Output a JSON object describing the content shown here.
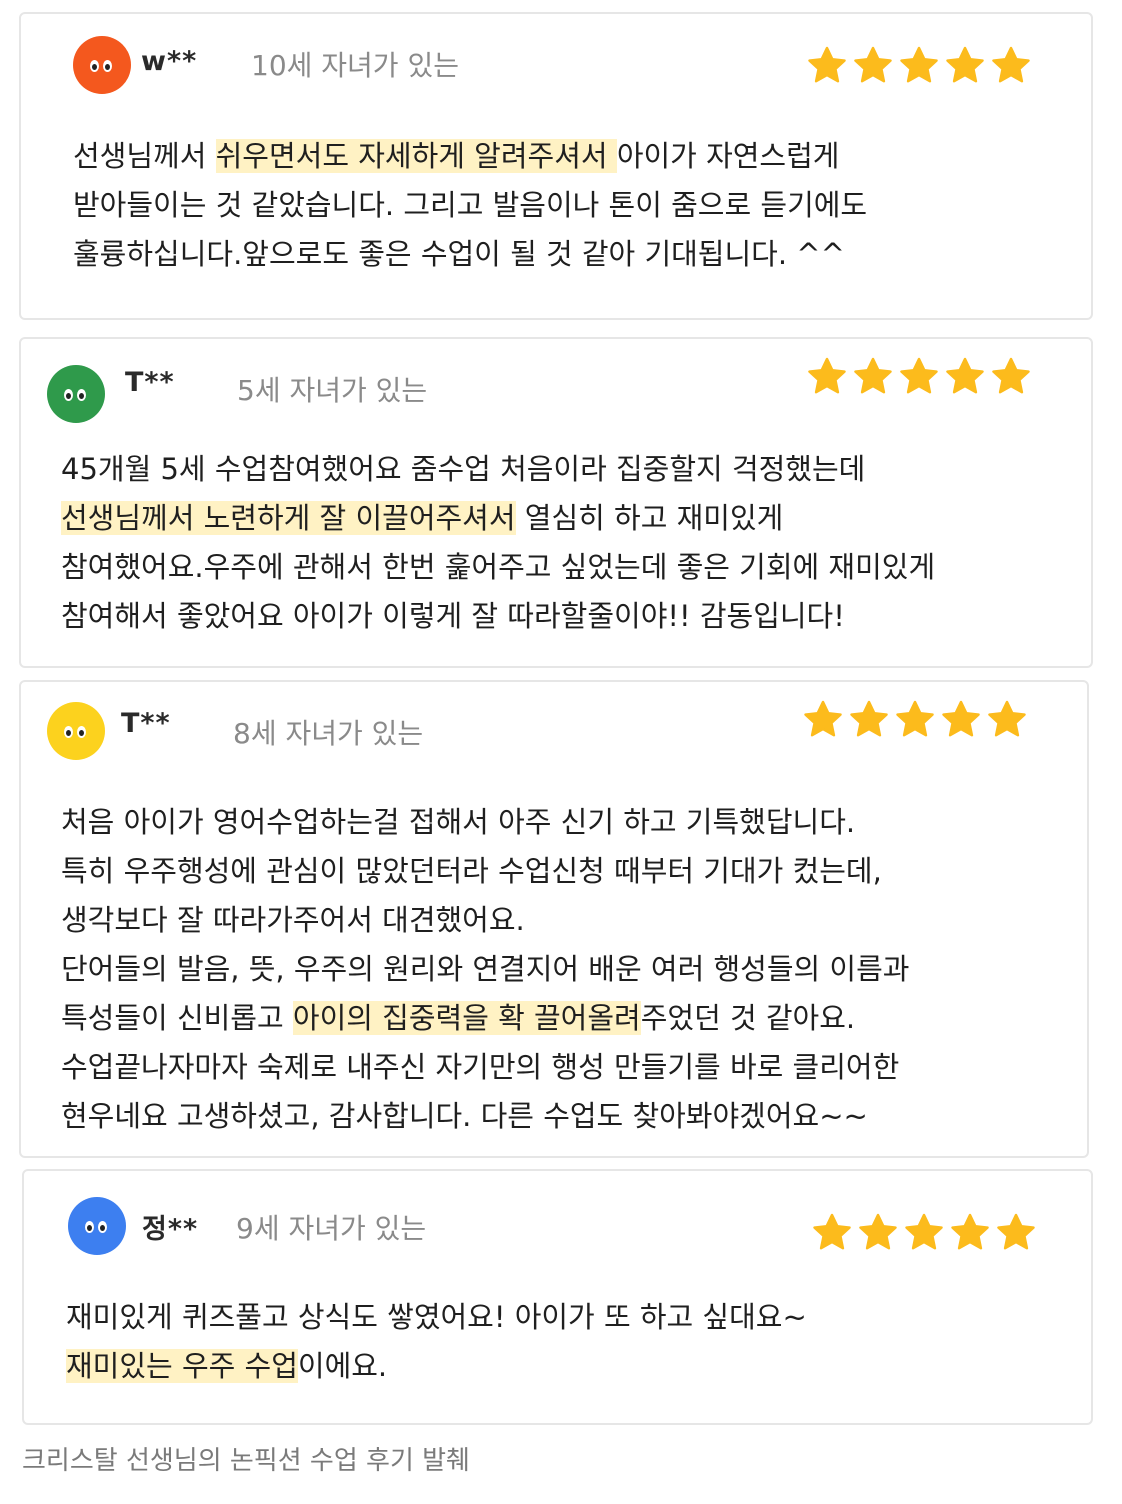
{
  "colors": {
    "star": "#fcbb1c",
    "highlight": "#fff2c4",
    "avatar_orange": "#f4581e",
    "avatar_green": "#2f9a4b",
    "avatar_yellow": "#fcd21e",
    "avatar_blue": "#3d7ff0"
  },
  "icons": {
    "rating": "star-icon",
    "avatar": "face-blob-icon"
  },
  "reviews": [
    {
      "name": "w**",
      "age": "10세 자녀가 있는",
      "rating": 5,
      "lines": [
        {
          "pre": "선생님께서 ",
          "hl": "쉬우면서도 자세하게 알려주셔서 ",
          "post": "아이가 자연스럽게"
        },
        {
          "pre": "받아들이는 것 같았습니다. 그리고 발음이나 톤이 줌으로 듣기에도",
          "hl": "",
          "post": ""
        },
        {
          "pre": "훌륭하십니다.앞으로도 좋은 수업이 될 것 같아 기대됩니다. ^^",
          "hl": "",
          "post": ""
        }
      ]
    },
    {
      "name": "T**",
      "age": "5세 자녀가 있는",
      "rating": 5,
      "lines": [
        {
          "pre": "45개월 5세 수업참여했어요 줌수업 처음이라 집중할지 걱정했는데",
          "hl": "",
          "post": ""
        },
        {
          "pre": "",
          "hl": "선생님께서 노련하게 잘 이끌어주셔서",
          "post": " 열심히 하고 재미있게"
        },
        {
          "pre": "참여했어요.우주에 관해서 한번 훑어주고 싶었는데 좋은 기회에 재미있게",
          "hl": "",
          "post": ""
        },
        {
          "pre": "참여해서 좋았어요 아이가 이렇게 잘 따라할줄이야!! 감동입니다!",
          "hl": "",
          "post": ""
        }
      ]
    },
    {
      "name": "T**",
      "age": "8세 자녀가 있는",
      "rating": 5,
      "lines": [
        {
          "pre": "처음 아이가 영어수업하는걸 접해서 아주 신기 하고 기특했답니다.",
          "hl": "",
          "post": ""
        },
        {
          "pre": "특히 우주행성에 관심이 많았던터라 수업신청 때부터 기대가 컸는데,",
          "hl": "",
          "post": ""
        },
        {
          "pre": "생각보다 잘 따라가주어서 대견했어요.",
          "hl": "",
          "post": ""
        },
        {
          "pre": "단어들의 발음, 뜻, 우주의 원리와 연결지어 배운 여러 행성들의 이름과",
          "hl": "",
          "post": ""
        },
        {
          "pre": "특성들이 신비롭고 ",
          "hl": "아이의 집중력을 확 끌어올려",
          "post": "주었던 것 같아요."
        },
        {
          "pre": "수업끝나자마자 숙제로 내주신 자기만의 행성 만들기를 바로 클리어한",
          "hl": "",
          "post": ""
        },
        {
          "pre": "현우네요 고생하셨고, 감사합니다. 다른 수업도 찾아봐야겠어요~~",
          "hl": "",
          "post": ""
        }
      ]
    },
    {
      "name": "정**",
      "age": "9세 자녀가 있는",
      "rating": 5,
      "lines": [
        {
          "pre": "재미있게 퀴즈풀고 상식도 쌓였어요! 아이가 또 하고 싶대요~",
          "hl": "",
          "post": ""
        },
        {
          "pre": "",
          "hl": "재미있는 우주 수업",
          "post": "이에요."
        }
      ]
    }
  ],
  "caption": "크리스탈 선생님의 논픽션 수업 후기 발췌"
}
